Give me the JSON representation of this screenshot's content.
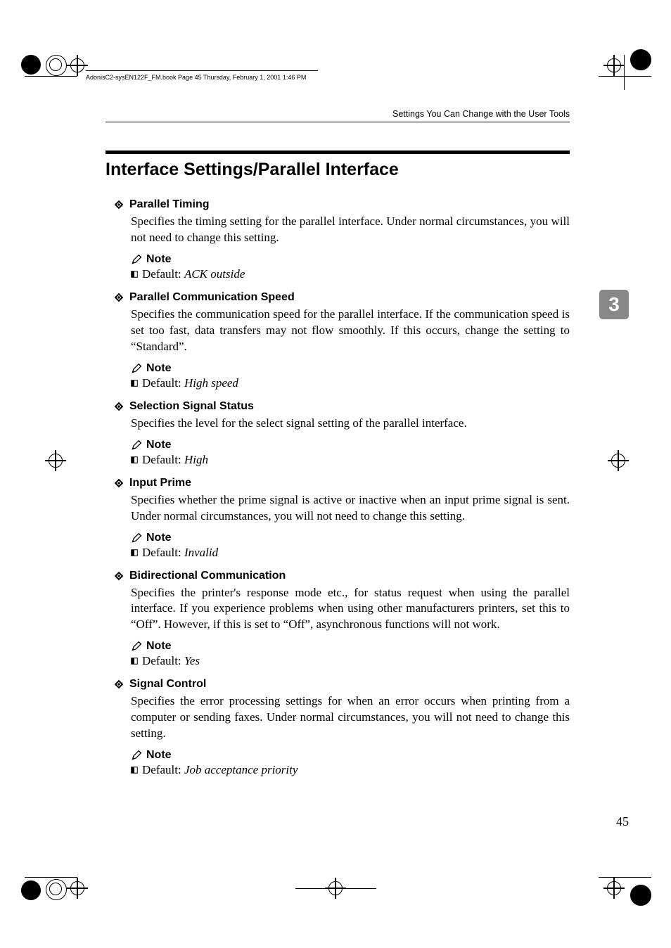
{
  "book_header": "AdonisC2-sysEN122F_FM.book  Page 45  Thursday, February 1, 2001  1:46 PM",
  "running_header": "Settings You Can Change with the User Tools",
  "section_title": "Interface Settings/Parallel Interface",
  "chapter_number": "3",
  "page_number": "45",
  "note_label": "Note",
  "default_label": "Default: ",
  "items": [
    {
      "title": "Parallel Timing",
      "body": "Specifies the timing setting for the parallel interface. Under normal circumstances, you will not need to change this setting.",
      "default": "ACK outside"
    },
    {
      "title": "Parallel Communication Speed",
      "body": "Specifies the communication speed for the parallel interface. If the communication speed is set too fast, data transfers may not flow smoothly. If this occurs, change the setting to “Standard”.",
      "default": "High speed"
    },
    {
      "title": "Selection Signal Status",
      "body": "Specifies the level for the select signal setting of the parallel interface.",
      "default": "High"
    },
    {
      "title": "Input Prime",
      "body": "Specifies whether the prime signal is active or inactive when an input prime signal is sent. Under normal circumstances, you will not need to change this setting.",
      "default": "Invalid"
    },
    {
      "title": "Bidirectional Communication",
      "body": "Specifies the printer's response mode etc., for status request when using the parallel interface. If you experience problems when using other manufacturers printers, set this to “Off”. However, if this is set to “Off”, asynchronous functions will not work.",
      "default": "Yes"
    },
    {
      "title": "Signal Control",
      "body": "Specifies the error processing settings for when an error occurs when printing from a computer or sending faxes. Under normal circumstances, you will not need to change this setting.",
      "default": "Job acceptance priority"
    }
  ]
}
